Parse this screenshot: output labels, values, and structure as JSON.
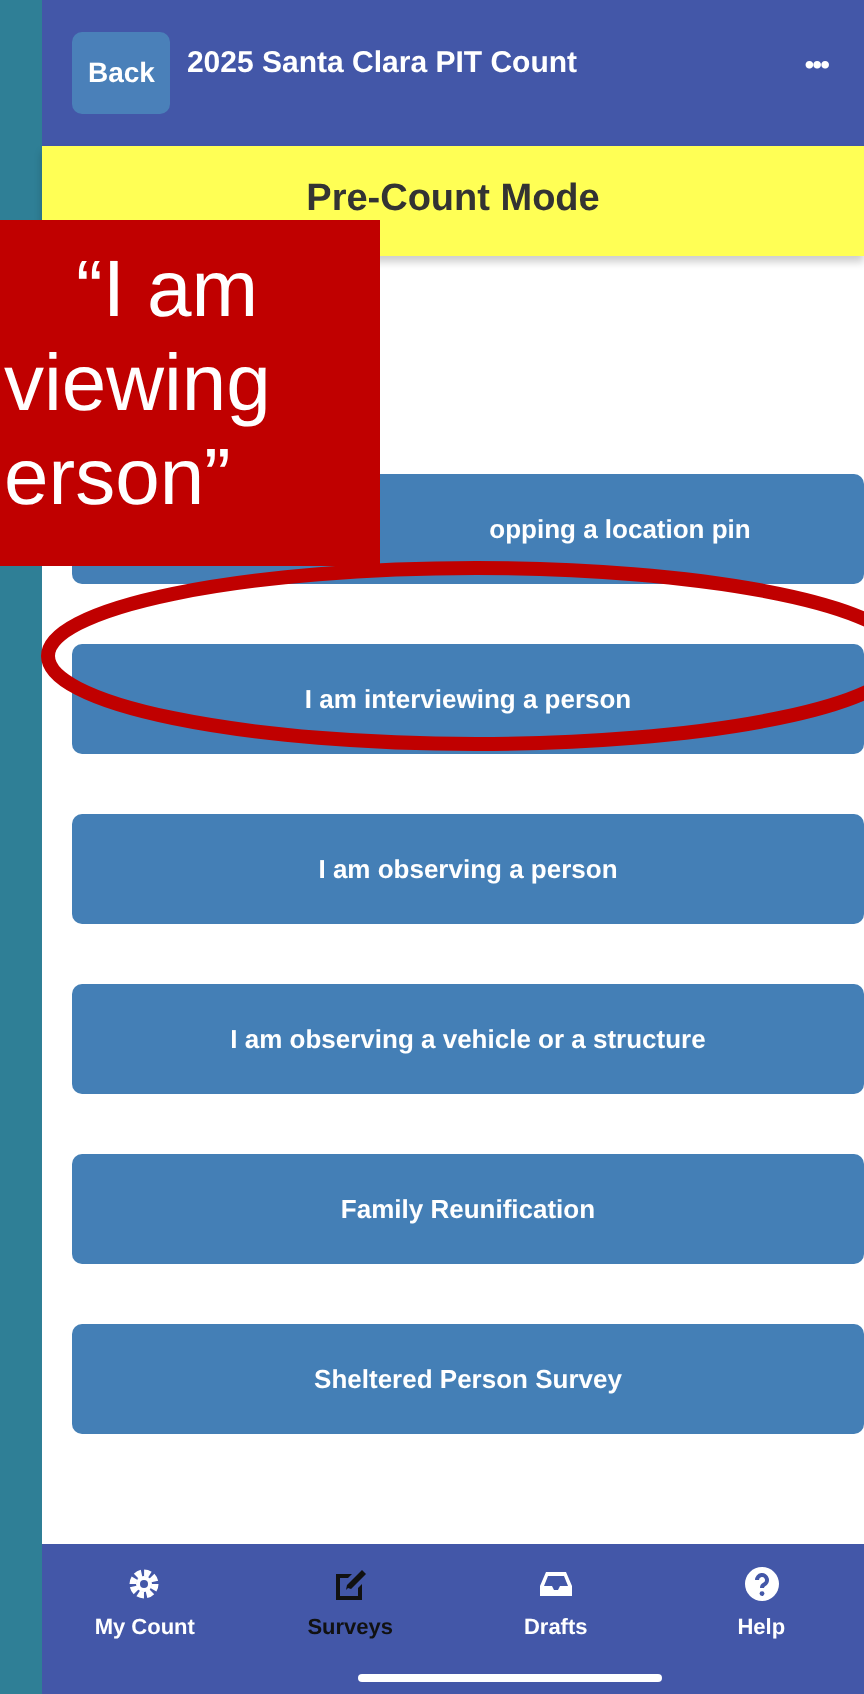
{
  "header": {
    "back_button": "Back",
    "title": "2025 Santa Clara PIT Count",
    "more_button": "•••"
  },
  "mode_banner": "Pre-Count Mode",
  "survey_buttons": [
    {
      "label": "opping a location pin",
      "kind": "partial",
      "highlighted": false
    },
    {
      "label": "I am interviewing a person",
      "kind": "full",
      "highlighted": true
    },
    {
      "label": "I am observing a person",
      "kind": "full",
      "highlighted": false
    },
    {
      "label": "I am observing a vehicle or a structure",
      "kind": "full",
      "highlighted": false
    },
    {
      "label": "Family Reunification",
      "kind": "full",
      "highlighted": false
    },
    {
      "label": "Sheltered Person Survey",
      "kind": "full",
      "highlighted": false
    }
  ],
  "callout": {
    "text": "“I am\nviewing\nerson”"
  },
  "bottom_nav": [
    {
      "label": "My Count",
      "selected": false
    },
    {
      "label": "Surveys",
      "selected": true
    },
    {
      "label": "Drafts",
      "selected": false
    },
    {
      "label": "Help",
      "selected": false
    }
  ]
}
